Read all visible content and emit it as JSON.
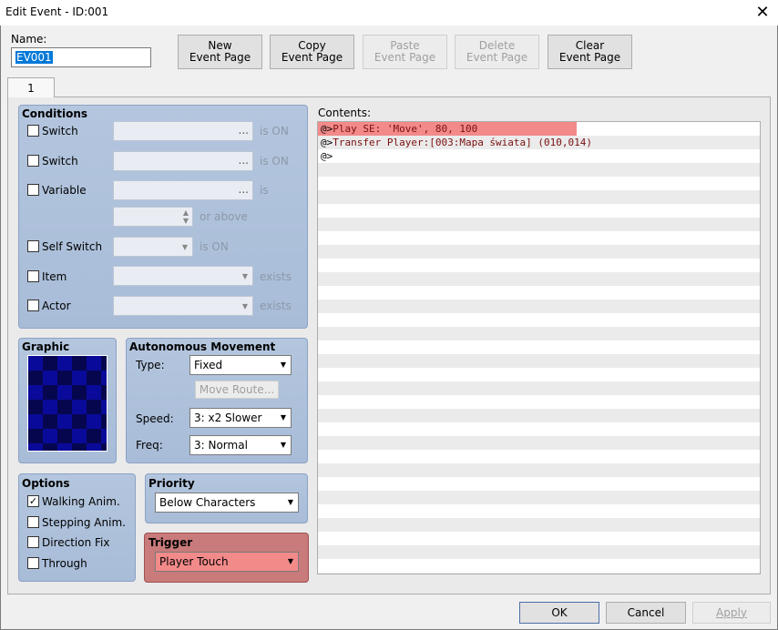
{
  "window": {
    "title": "Edit Event - ID:001",
    "close": "✕"
  },
  "name": {
    "label": "Name:",
    "value": "EV001"
  },
  "toolbar": {
    "new": "New\nEvent Page",
    "copy": "Copy\nEvent Page",
    "paste": "Paste\nEvent Page",
    "delete": "Delete\nEvent Page",
    "clear": "Clear\nEvent Page"
  },
  "tabs": [
    {
      "label": "1"
    }
  ],
  "conditions": {
    "title": "Conditions",
    "switch1": {
      "label": "Switch",
      "suffix": "is ON",
      "dots": "..."
    },
    "switch2": {
      "label": "Switch",
      "suffix": "is ON",
      "dots": "..."
    },
    "variable": {
      "label": "Variable",
      "suffix": "is",
      "dots": "...",
      "above": "or above"
    },
    "self_switch": {
      "label": "Self Switch",
      "suffix": "is ON"
    },
    "item": {
      "label": "Item",
      "suffix": "exists"
    },
    "actor": {
      "label": "Actor",
      "suffix": "exists"
    }
  },
  "graphic": {
    "title": "Graphic"
  },
  "movement": {
    "title": "Autonomous Movement",
    "type_label": "Type:",
    "type_value": "Fixed",
    "move_route": "Move Route...",
    "speed_label": "Speed:",
    "speed_value": "3: x2 Slower",
    "freq_label": "Freq:",
    "freq_value": "3: Normal"
  },
  "options": {
    "title": "Options",
    "walking": {
      "label": "Walking Anim.",
      "checked": true
    },
    "stepping": {
      "label": "Stepping Anim.",
      "checked": false
    },
    "direction": {
      "label": "Direction Fix",
      "checked": false
    },
    "through": {
      "label": "Through",
      "checked": false
    }
  },
  "priority": {
    "title": "Priority",
    "value": "Below Characters"
  },
  "trigger": {
    "title": "Trigger",
    "value": "Player Touch"
  },
  "contents": {
    "label": "Contents:",
    "lines": [
      {
        "prefix": "@>",
        "text": "Play SE: 'Move', 80, 100"
      },
      {
        "prefix": "@>",
        "text": "Transfer Player:[003:Mapa świata] (010,014)"
      },
      {
        "prefix": "@>",
        "text": ""
      }
    ]
  },
  "footer": {
    "ok": "OK",
    "cancel": "Cancel",
    "apply": "Apply"
  },
  "colors": {
    "highlight": "#f38a8a",
    "panel": "#b0c3dc",
    "command_text": "#7a1010"
  }
}
